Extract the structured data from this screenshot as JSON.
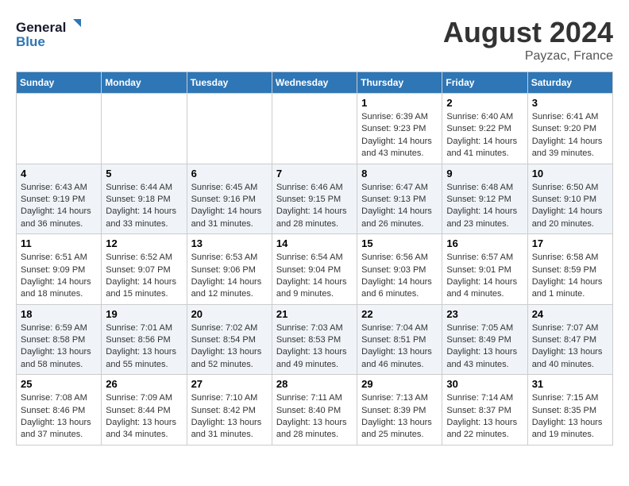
{
  "header": {
    "title": "August 2024",
    "location": "Payzac, France",
    "logo_line1": "General",
    "logo_line2": "Blue"
  },
  "days_of_week": [
    "Sunday",
    "Monday",
    "Tuesday",
    "Wednesday",
    "Thursday",
    "Friday",
    "Saturday"
  ],
  "weeks": [
    [
      {
        "day": "",
        "info": ""
      },
      {
        "day": "",
        "info": ""
      },
      {
        "day": "",
        "info": ""
      },
      {
        "day": "",
        "info": ""
      },
      {
        "day": "1",
        "info": "Sunrise: 6:39 AM\nSunset: 9:23 PM\nDaylight: 14 hours and 43 minutes."
      },
      {
        "day": "2",
        "info": "Sunrise: 6:40 AM\nSunset: 9:22 PM\nDaylight: 14 hours and 41 minutes."
      },
      {
        "day": "3",
        "info": "Sunrise: 6:41 AM\nSunset: 9:20 PM\nDaylight: 14 hours and 39 minutes."
      }
    ],
    [
      {
        "day": "4",
        "info": "Sunrise: 6:43 AM\nSunset: 9:19 PM\nDaylight: 14 hours and 36 minutes."
      },
      {
        "day": "5",
        "info": "Sunrise: 6:44 AM\nSunset: 9:18 PM\nDaylight: 14 hours and 33 minutes."
      },
      {
        "day": "6",
        "info": "Sunrise: 6:45 AM\nSunset: 9:16 PM\nDaylight: 14 hours and 31 minutes."
      },
      {
        "day": "7",
        "info": "Sunrise: 6:46 AM\nSunset: 9:15 PM\nDaylight: 14 hours and 28 minutes."
      },
      {
        "day": "8",
        "info": "Sunrise: 6:47 AM\nSunset: 9:13 PM\nDaylight: 14 hours and 26 minutes."
      },
      {
        "day": "9",
        "info": "Sunrise: 6:48 AM\nSunset: 9:12 PM\nDaylight: 14 hours and 23 minutes."
      },
      {
        "day": "10",
        "info": "Sunrise: 6:50 AM\nSunset: 9:10 PM\nDaylight: 14 hours and 20 minutes."
      }
    ],
    [
      {
        "day": "11",
        "info": "Sunrise: 6:51 AM\nSunset: 9:09 PM\nDaylight: 14 hours and 18 minutes."
      },
      {
        "day": "12",
        "info": "Sunrise: 6:52 AM\nSunset: 9:07 PM\nDaylight: 14 hours and 15 minutes."
      },
      {
        "day": "13",
        "info": "Sunrise: 6:53 AM\nSunset: 9:06 PM\nDaylight: 14 hours and 12 minutes."
      },
      {
        "day": "14",
        "info": "Sunrise: 6:54 AM\nSunset: 9:04 PM\nDaylight: 14 hours and 9 minutes."
      },
      {
        "day": "15",
        "info": "Sunrise: 6:56 AM\nSunset: 9:03 PM\nDaylight: 14 hours and 6 minutes."
      },
      {
        "day": "16",
        "info": "Sunrise: 6:57 AM\nSunset: 9:01 PM\nDaylight: 14 hours and 4 minutes."
      },
      {
        "day": "17",
        "info": "Sunrise: 6:58 AM\nSunset: 8:59 PM\nDaylight: 14 hours and 1 minute."
      }
    ],
    [
      {
        "day": "18",
        "info": "Sunrise: 6:59 AM\nSunset: 8:58 PM\nDaylight: 13 hours and 58 minutes."
      },
      {
        "day": "19",
        "info": "Sunrise: 7:01 AM\nSunset: 8:56 PM\nDaylight: 13 hours and 55 minutes."
      },
      {
        "day": "20",
        "info": "Sunrise: 7:02 AM\nSunset: 8:54 PM\nDaylight: 13 hours and 52 minutes."
      },
      {
        "day": "21",
        "info": "Sunrise: 7:03 AM\nSunset: 8:53 PM\nDaylight: 13 hours and 49 minutes."
      },
      {
        "day": "22",
        "info": "Sunrise: 7:04 AM\nSunset: 8:51 PM\nDaylight: 13 hours and 46 minutes."
      },
      {
        "day": "23",
        "info": "Sunrise: 7:05 AM\nSunset: 8:49 PM\nDaylight: 13 hours and 43 minutes."
      },
      {
        "day": "24",
        "info": "Sunrise: 7:07 AM\nSunset: 8:47 PM\nDaylight: 13 hours and 40 minutes."
      }
    ],
    [
      {
        "day": "25",
        "info": "Sunrise: 7:08 AM\nSunset: 8:46 PM\nDaylight: 13 hours and 37 minutes."
      },
      {
        "day": "26",
        "info": "Sunrise: 7:09 AM\nSunset: 8:44 PM\nDaylight: 13 hours and 34 minutes."
      },
      {
        "day": "27",
        "info": "Sunrise: 7:10 AM\nSunset: 8:42 PM\nDaylight: 13 hours and 31 minutes."
      },
      {
        "day": "28",
        "info": "Sunrise: 7:11 AM\nSunset: 8:40 PM\nDaylight: 13 hours and 28 minutes."
      },
      {
        "day": "29",
        "info": "Sunrise: 7:13 AM\nSunset: 8:39 PM\nDaylight: 13 hours and 25 minutes."
      },
      {
        "day": "30",
        "info": "Sunrise: 7:14 AM\nSunset: 8:37 PM\nDaylight: 13 hours and 22 minutes."
      },
      {
        "day": "31",
        "info": "Sunrise: 7:15 AM\nSunset: 8:35 PM\nDaylight: 13 hours and 19 minutes."
      }
    ]
  ]
}
